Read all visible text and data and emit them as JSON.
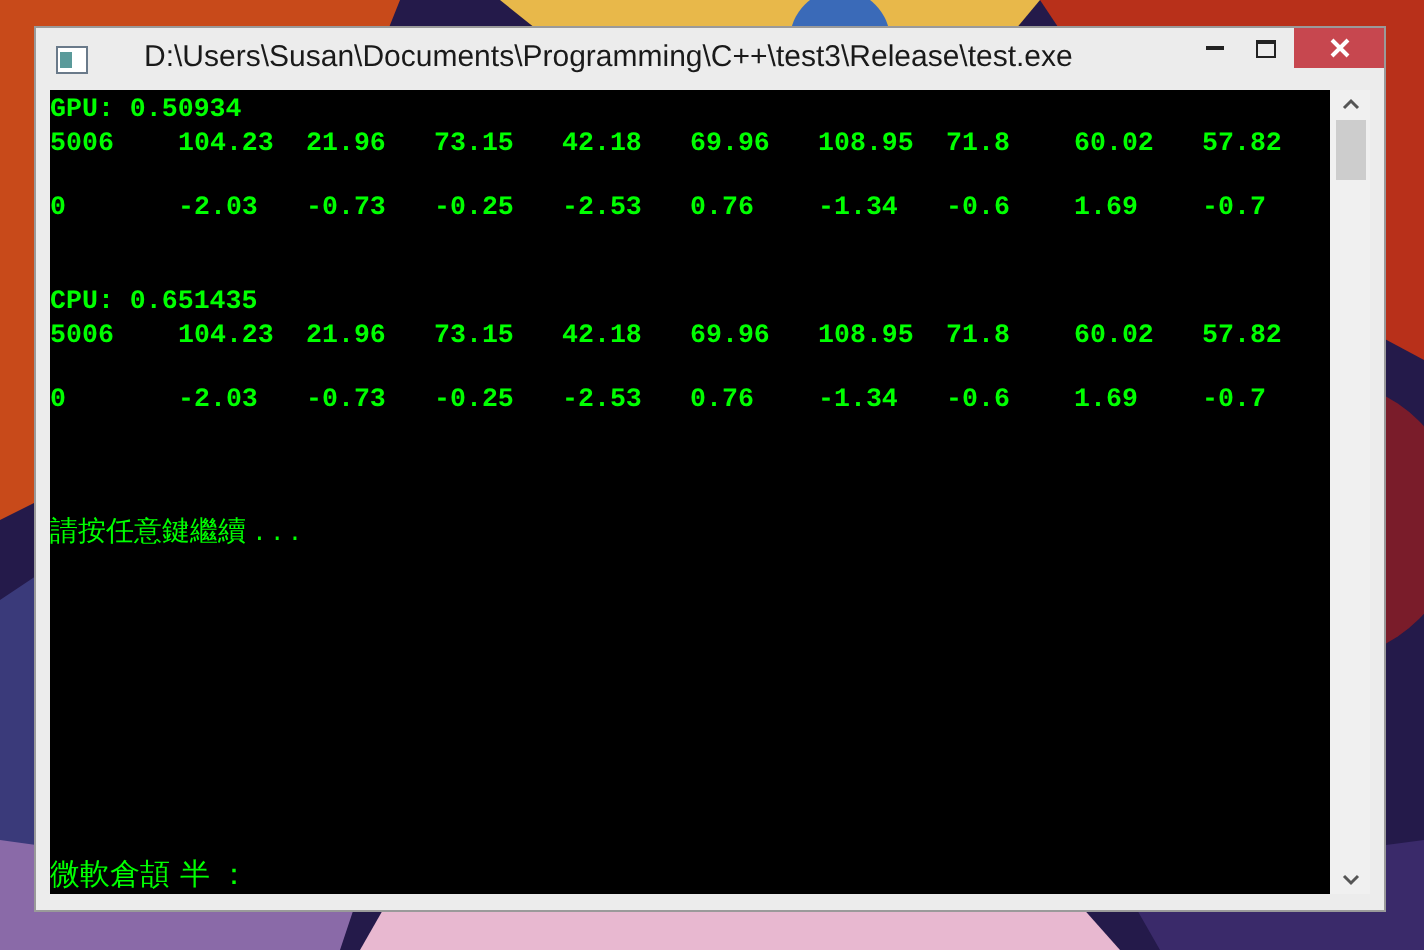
{
  "window": {
    "title": "D:\\Users\\Susan\\Documents\\Programming\\C++\\test3\\Release\\test.exe"
  },
  "console": [
    {
      "kind": "text",
      "text": "GPU: 0.50934"
    },
    {
      "kind": "row",
      "cells": [
        "5006",
        "104.23",
        "21.96",
        "73.15",
        "42.18",
        "69.96",
        "108.95",
        "71.8",
        "60.02",
        "57.82"
      ]
    },
    {
      "kind": "blank"
    },
    {
      "kind": "row",
      "cells": [
        "0",
        "-2.03",
        "-0.73",
        "-0.25",
        "-2.53",
        "0.76",
        "-1.34",
        "-0.6",
        "1.69",
        "-0.7"
      ]
    },
    {
      "kind": "blank"
    },
    {
      "kind": "blank"
    },
    {
      "kind": "text",
      "text": "CPU: 0.651435"
    },
    {
      "kind": "row",
      "cells": [
        "5006",
        "104.23",
        "21.96",
        "73.15",
        "42.18",
        "69.96",
        "108.95",
        "71.8",
        "60.02",
        "57.82"
      ]
    },
    {
      "kind": "blank"
    },
    {
      "kind": "row",
      "cells": [
        "0",
        "-2.03",
        "-0.73",
        "-0.25",
        "-2.53",
        "0.76",
        "-1.34",
        "-0.6",
        "1.69",
        "-0.7"
      ]
    },
    {
      "kind": "blank"
    },
    {
      "kind": "blank"
    },
    {
      "kind": "blank"
    },
    {
      "kind": "prompt",
      "text": "請按任意鍵繼續 . . ."
    }
  ],
  "ime_status": "微軟倉頡 半 ："
}
